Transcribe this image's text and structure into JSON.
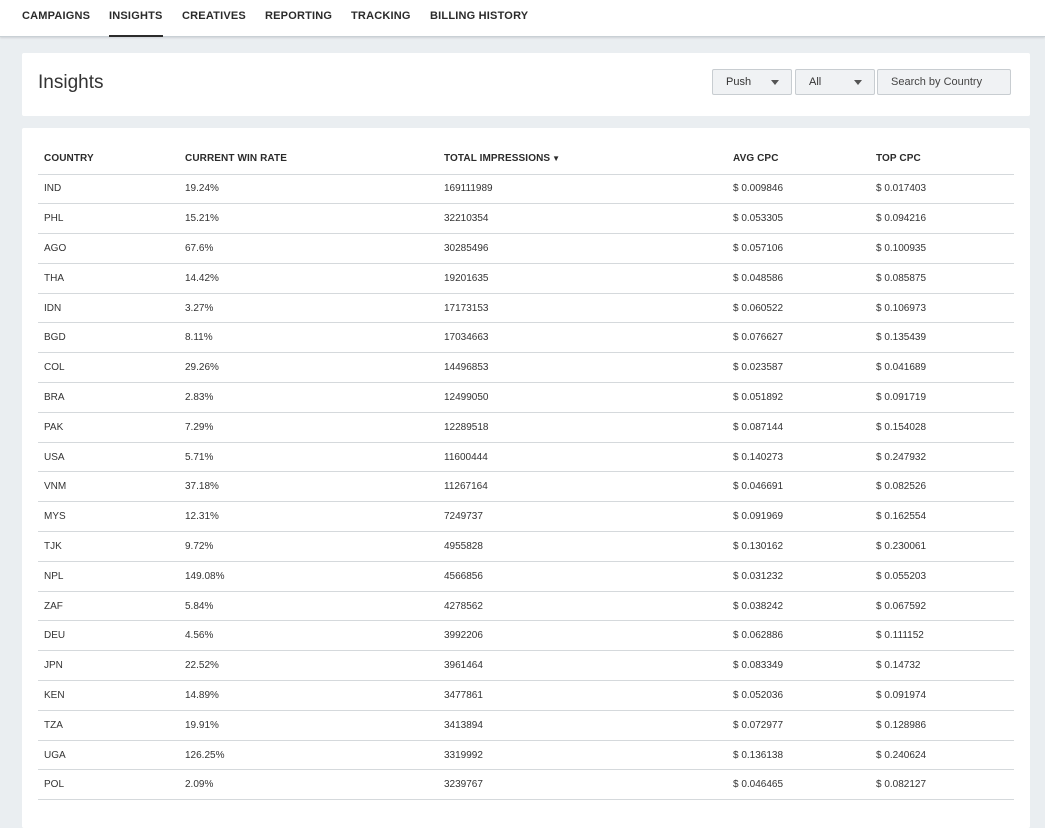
{
  "nav": {
    "tabs": [
      {
        "label": "CAMPAIGNS"
      },
      {
        "label": "INSIGHTS"
      },
      {
        "label": "CREATIVES"
      },
      {
        "label": "REPORTING"
      },
      {
        "label": "TRACKING"
      },
      {
        "label": "BILLING HISTORY"
      }
    ],
    "active_tab": "INSIGHTS"
  },
  "header": {
    "title": "Insights",
    "type_select": {
      "value": "Push"
    },
    "filter_select": {
      "value": "All"
    },
    "search": {
      "placeholder": "Search by Country",
      "value": ""
    }
  },
  "table": {
    "columns": [
      "COUNTRY",
      "CURRENT WIN RATE",
      "TOTAL IMPRESSIONS",
      "AVG CPC",
      "TOP CPC"
    ],
    "sort": {
      "column": "TOTAL IMPRESSIONS",
      "direction": "desc",
      "icon": "sort-desc-icon"
    },
    "rows": [
      [
        "IND",
        "19.24%",
        "169111989",
        "$ 0.009846",
        "$ 0.017403"
      ],
      [
        "PHL",
        "15.21%",
        "32210354",
        "$ 0.053305",
        "$ 0.094216"
      ],
      [
        "AGO",
        "67.6%",
        "30285496",
        "$ 0.057106",
        "$ 0.100935"
      ],
      [
        "THA",
        "14.42%",
        "19201635",
        "$ 0.048586",
        "$ 0.085875"
      ],
      [
        "IDN",
        "3.27%",
        "17173153",
        "$ 0.060522",
        "$ 0.106973"
      ],
      [
        "BGD",
        "8.11%",
        "17034663",
        "$ 0.076627",
        "$ 0.135439"
      ],
      [
        "COL",
        "29.26%",
        "14496853",
        "$ 0.023587",
        "$ 0.041689"
      ],
      [
        "BRA",
        "2.83%",
        "12499050",
        "$ 0.051892",
        "$ 0.091719"
      ],
      [
        "PAK",
        "7.29%",
        "12289518",
        "$ 0.087144",
        "$ 0.154028"
      ],
      [
        "USA",
        "5.71%",
        "11600444",
        "$ 0.140273",
        "$ 0.247932"
      ],
      [
        "VNM",
        "37.18%",
        "11267164",
        "$ 0.046691",
        "$ 0.082526"
      ],
      [
        "MYS",
        "12.31%",
        "7249737",
        "$ 0.091969",
        "$ 0.162554"
      ],
      [
        "TJK",
        "9.72%",
        "4955828",
        "$ 0.130162",
        "$ 0.230061"
      ],
      [
        "NPL",
        "149.08%",
        "4566856",
        "$ 0.031232",
        "$ 0.055203"
      ],
      [
        "ZAF",
        "5.84%",
        "4278562",
        "$ 0.038242",
        "$ 0.067592"
      ],
      [
        "DEU",
        "4.56%",
        "3992206",
        "$ 0.062886",
        "$ 0.111152"
      ],
      [
        "JPN",
        "22.52%",
        "3961464",
        "$ 0.083349",
        "$ 0.14732"
      ],
      [
        "KEN",
        "14.89%",
        "3477861",
        "$ 0.052036",
        "$ 0.091974"
      ],
      [
        "TZA",
        "19.91%",
        "3413894",
        "$ 0.072977",
        "$ 0.128986"
      ],
      [
        "UGA",
        "126.25%",
        "3319992",
        "$ 0.136138",
        "$ 0.240624"
      ],
      [
        "POL",
        "2.09%",
        "3239767",
        "$ 0.046465",
        "$ 0.082127"
      ]
    ]
  }
}
